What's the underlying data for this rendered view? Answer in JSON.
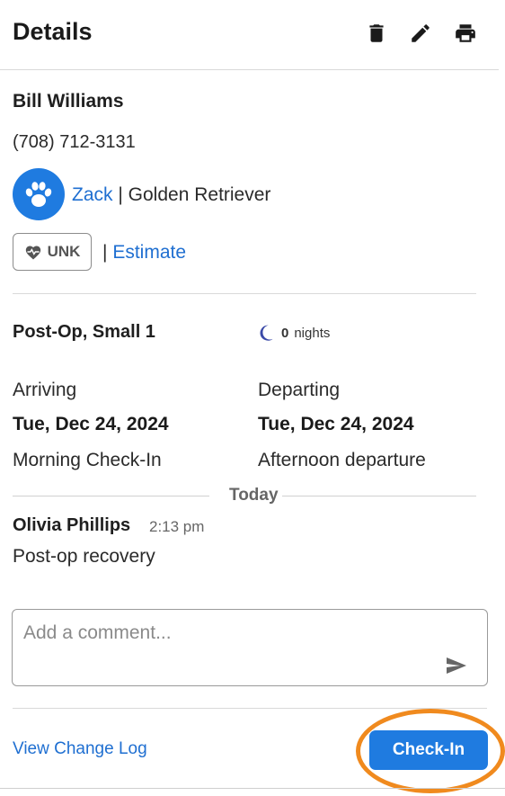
{
  "header": {
    "title": "Details",
    "icons": [
      "trash-icon",
      "pencil-icon",
      "printer-icon"
    ]
  },
  "owner": {
    "name": "Bill Williams",
    "phone": "(708) 712-3131"
  },
  "pet": {
    "icon": "paw-icon",
    "name": "Zack",
    "separator": "|",
    "breed": "Golden Retriever"
  },
  "health": {
    "icon": "heart-pulse-icon",
    "status": "UNK",
    "separator": "|",
    "estimate_label": "Estimate"
  },
  "reservation": {
    "name": "Post-Op, Small 1",
    "nights_icon": "moon-icon",
    "nights_count": "0",
    "nights_label": "nights",
    "arriving_label": "Arriving",
    "arriving_date": "Tue, Dec 24, 2024",
    "arriving_note": "Morning Check-In",
    "departing_label": "Departing",
    "departing_date": "Tue, Dec 24, 2024",
    "departing_note": "Afternoon departure"
  },
  "timeline": {
    "day_label": "Today",
    "comments": [
      {
        "author": "Olivia Phillips",
        "time": "2:13 pm",
        "text": "Post-op recovery"
      }
    ]
  },
  "comment_input": {
    "placeholder": "Add a comment...",
    "value": "",
    "send_icon": "send-icon"
  },
  "footer": {
    "view_log_label": "View Change Log",
    "checkin_label": "Check-In"
  },
  "colors": {
    "accent": "#1f7be0",
    "link": "#1f6fd1",
    "highlight": "#f08a1e",
    "moon": "#3b4aa8"
  }
}
